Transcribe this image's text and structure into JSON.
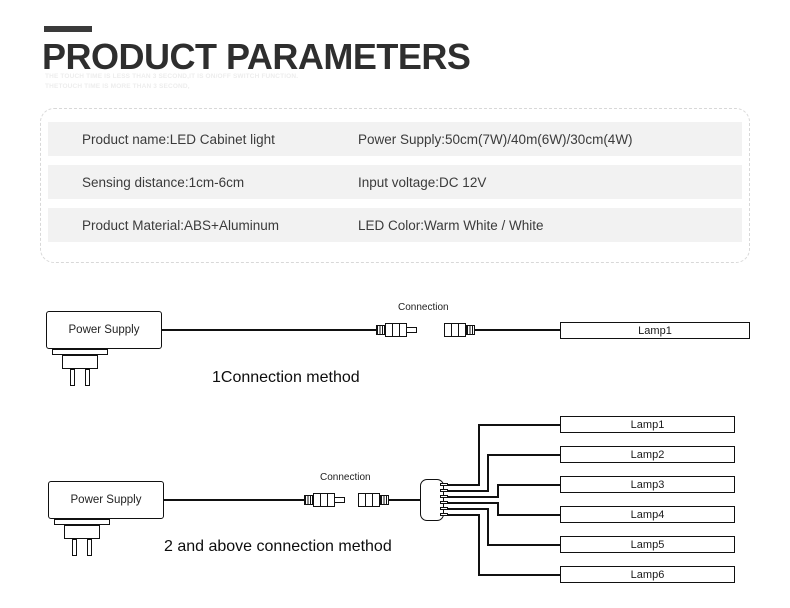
{
  "header": {
    "title": "PRODUCT PARAMETERS",
    "subtitle_line1": "THE TOUCH TIME IS LESS THAN 3 SECOND,IT IS ON/OFF SWITCH FUNCTION.",
    "subtitle_line2": "THETOUCH TIME IS MORE THAN 3 SECOND,",
    "accent_color": "#3a3a3a"
  },
  "spec_table": {
    "row_background": "#f2f2f2",
    "border_color": "#d8d8d8",
    "rows": [
      {
        "left": "Product name:LED Cabinet light",
        "right": "Power Supply:50cm(7W)/40m(6W)/30cm(4W)"
      },
      {
        "left": "Sensing distance:1cm-6cm",
        "right": "Input voltage:DC 12V"
      },
      {
        "left": "Product Material:ABS+Aluminum",
        "right": "LED Color:Warm White / White"
      }
    ]
  },
  "diagram1": {
    "power_supply_label": "Power Supply",
    "connection_label": "Connection",
    "caption": "1Connection method",
    "lamps": [
      "Lamp1"
    ]
  },
  "diagram2": {
    "power_supply_label": "Power Supply",
    "connection_label": "Connection",
    "caption": "2 and above connection method",
    "lamps": [
      "Lamp1",
      "Lamp2",
      "Lamp3",
      "Lamp4",
      "Lamp5",
      "Lamp6"
    ]
  }
}
